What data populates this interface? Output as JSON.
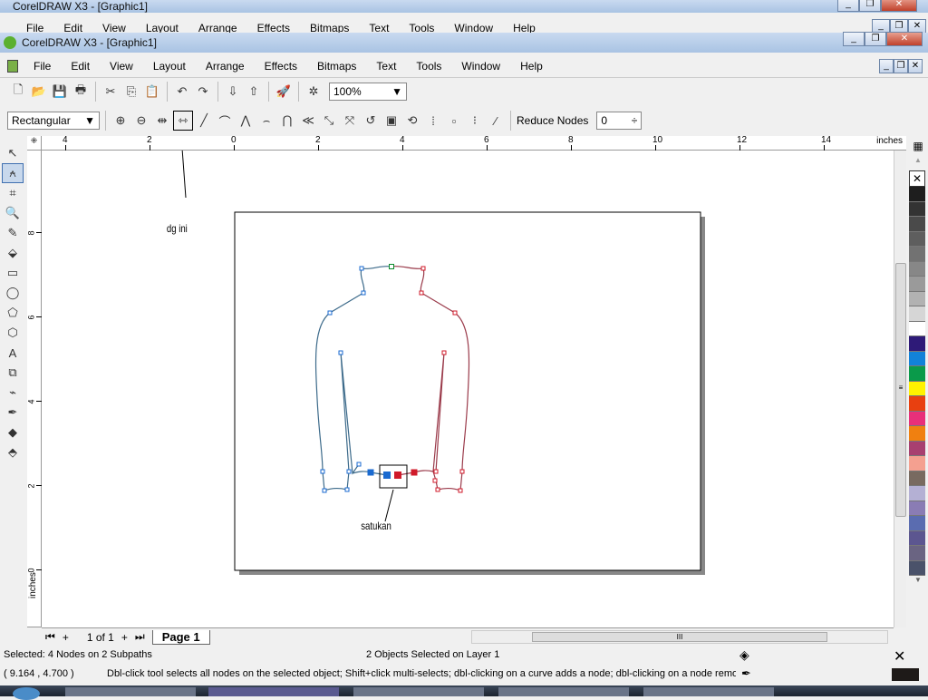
{
  "back_window": {
    "title": "CorelDRAW X3 - [Graphic1]",
    "menu": [
      "File",
      "Edit",
      "View",
      "Layout",
      "Arrange",
      "Effects",
      "Bitmaps",
      "Text",
      "Tools",
      "Window",
      "Help"
    ]
  },
  "window": {
    "title": "CorelDRAW X3 - [Graphic1]"
  },
  "menu": [
    "File",
    "Edit",
    "View",
    "Layout",
    "Arrange",
    "Effects",
    "Bitmaps",
    "Text",
    "Tools",
    "Window",
    "Help"
  ],
  "standard_toolbar": {
    "icons": [
      "new-icon",
      "open-icon",
      "save-icon",
      "print-icon",
      "cut-icon",
      "copy-icon",
      "paste-icon",
      "undo-icon",
      "redo-icon",
      "import-icon",
      "export-icon",
      "launcher-icon",
      "welcome-icon"
    ],
    "zoom": "100%"
  },
  "property_bar": {
    "selection_mode": "Rectangular",
    "icons": [
      "add-node-icon",
      "delete-node-icon",
      "join-nodes-icon",
      "break-curve-icon",
      "to-line-icon",
      "to-curve-icon",
      "cusp-icon",
      "smooth-icon",
      "symmetrical-icon",
      "reverse-direction-icon",
      "extend-curve-icon",
      "extract-subpath-icon",
      "stretch-nodes-icon",
      "rotate-nodes-icon",
      "align-nodes-icon",
      "mirror-h-icon",
      "mirror-v-icon",
      "elastic-mode-icon",
      "select-all-nodes-icon"
    ],
    "reduce_nodes_label": "Reduce Nodes",
    "reduce_nodes_value": "0"
  },
  "ruler": {
    "unit": "inches",
    "h_ticks": [
      "4",
      "2",
      "0",
      "2",
      "4",
      "6",
      "8",
      "10",
      "12",
      "14"
    ],
    "v_ticks": [
      "8",
      "6",
      "4",
      "2",
      "0"
    ],
    "v_unit": "inches"
  },
  "toolbox": [
    "pick-tool-icon",
    "shape-tool-icon",
    "crop-tool-icon",
    "zoom-tool-icon",
    "freehand-tool-icon",
    "smart-fill-icon",
    "rectangle-tool-icon",
    "ellipse-tool-icon",
    "polygon-tool-icon",
    "basic-shapes-icon",
    "text-tool-icon",
    "interactive-blend-icon",
    "eyedropper-icon",
    "outline-tool-icon",
    "fill-tool-icon",
    "interactive-fill-icon"
  ],
  "annotations": {
    "left": "dg ini",
    "bottom": "satukan"
  },
  "palette": [
    "#1e1e1e",
    "#333333",
    "#4a4a4a",
    "#5e5e5e",
    "#727272",
    "#878787",
    "#9a9a9a",
    "#b2b2b2",
    "#d6d6d6",
    "#ffffff",
    "#2e1a78",
    "#1282d8",
    "#0a9a4a",
    "#fff200",
    "#e84010",
    "#e8307a",
    "#f08010",
    "#a84070",
    "#f4a090",
    "#786a60",
    "#b4b0d4",
    "#8a7cb4",
    "#5a6cb0",
    "#5c5690",
    "#6a6482",
    "#4a526a"
  ],
  "page_nav": {
    "count": "1 of 1",
    "tab": "Page 1"
  },
  "status": {
    "selection": "Selected: 4 Nodes on 2 Subpaths",
    "layer": "2 Objects Selected on Layer 1",
    "coords": "( 9.164 , 4.700  )",
    "hint": "Dbl-click tool selects all nodes on the selected object; Shift+click multi-selects; dbl-clicking on a curve adds a node; dbl-clicking on a node remo..."
  }
}
